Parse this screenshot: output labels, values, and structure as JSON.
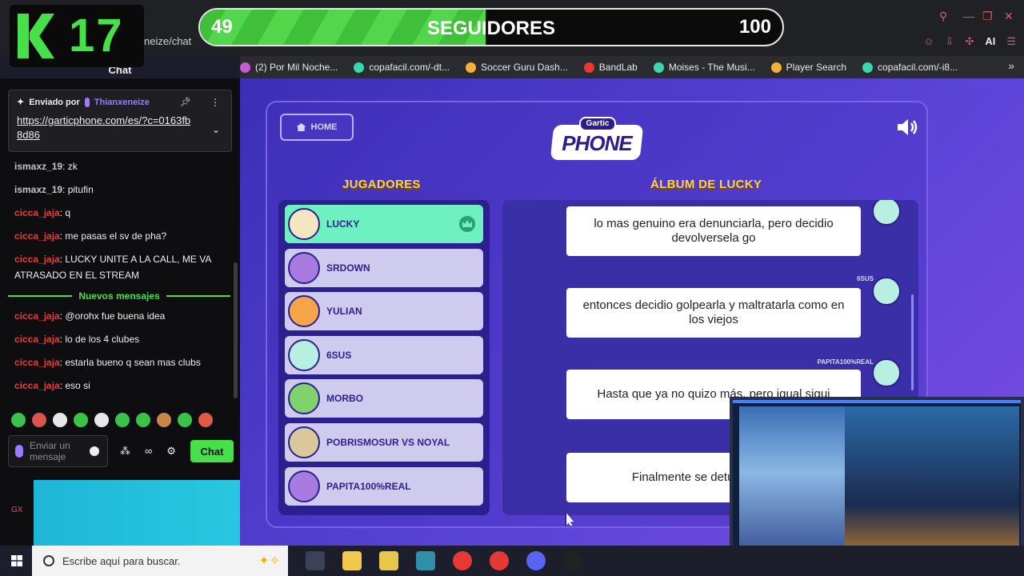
{
  "stream_overlay": {
    "logo_number": "17",
    "followers_current": "49",
    "followers_label": "SEGUIDORES",
    "followers_goal": "100",
    "followers_progress": 0.49,
    "accent": "#47e04a"
  },
  "browser": {
    "url_partial": "neize/chat",
    "bookmarks": [
      {
        "label": "(2) Por Mil Noche..."
      },
      {
        "label": "copafacil.com/-dt..."
      },
      {
        "label": "Soccer Guru Dash..."
      },
      {
        "label": "BandLab"
      },
      {
        "label": "Moises - The Musi..."
      },
      {
        "label": "Player Search"
      },
      {
        "label": "copafacil.com/-i8..."
      }
    ],
    "ai_label": "AI"
  },
  "chat": {
    "title": "Chat",
    "pinned": {
      "sent_by": "Enviado por",
      "user": "Thianxeneize",
      "link": "https://garticphone.com/es/?c=0163fb8d86"
    },
    "messages_before": [
      {
        "user": "ismaxz_19",
        "text": ": zk",
        "color": "grey"
      },
      {
        "user": "ismaxz_19",
        "text": ": pitufin",
        "color": "grey"
      },
      {
        "user": "cicca_jaja",
        "text": ": q",
        "color": "red"
      },
      {
        "user": "cicca_jaja",
        "text": ": me pasas el sv de pha?",
        "color": "red"
      },
      {
        "user": "cicca_jaja",
        "text": ": LUCKY UNITE A LA CALL, ME VA ATRASADO EN EL STREAM",
        "color": "red"
      }
    ],
    "new_messages_label": "Nuevos mensajes",
    "messages_after": [
      {
        "user": "cicca_jaja",
        "text": ": @orohx fue buena idea",
        "color": "red"
      },
      {
        "user": "cicca_jaja",
        "text": ": lo de los 4 clubes",
        "color": "red"
      },
      {
        "user": "cicca_jaja",
        "text": ": estarla bueno q sean mas clubs",
        "color": "red"
      },
      {
        "user": "cicca_jaja",
        "text": ": eso si",
        "color": "red"
      }
    ],
    "input_placeholder": "Enviar un mensaje",
    "send_label": "Chat",
    "side_label": "GX"
  },
  "gartic": {
    "home_label": "HOME",
    "logo_small": "Gartic",
    "logo_big": "PHONE",
    "players_header": "JUGADORES",
    "album_header": "ÁLBUM DE LUCKY",
    "players": [
      {
        "name": "LUCKY",
        "active": true
      },
      {
        "name": "SRDOWN",
        "active": false
      },
      {
        "name": "YULIAN",
        "active": false
      },
      {
        "name": "6SUS",
        "active": false
      },
      {
        "name": "MORBO",
        "active": false
      },
      {
        "name": "POBRISMOSUR VS NOYAL",
        "active": false
      },
      {
        "name": "PAPITA100%REAL",
        "active": false
      }
    ],
    "album_entries": [
      {
        "author": "",
        "text": "lo mas genuino era denunciarla, pero decidio devolversela go"
      },
      {
        "author": "6SUS",
        "text": "entonces decidio golpearla y maltratarla como en los viejos"
      },
      {
        "author": "PAPITA100%REAL",
        "text": "Hasta que ya no quizo más, pero igual sigui"
      },
      {
        "author": "",
        "text": "Finalmente se detuvo, y haxba"
      }
    ]
  },
  "taskbar": {
    "search_placeholder": "Escribe aquí para buscar."
  }
}
